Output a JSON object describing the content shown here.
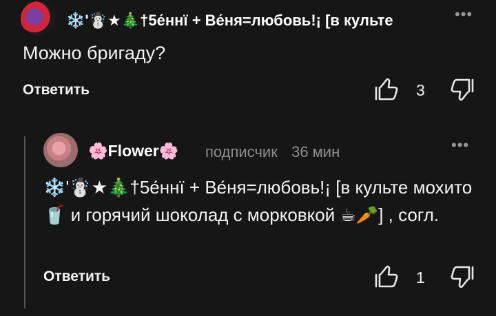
{
  "comment1": {
    "author": "❄️'☃️★🎄†5е́ннї + Ве́ня=любовь!¡ [в культе",
    "text": "Можно бригаду?",
    "reply_label": "Ответить",
    "like_count": "3",
    "menu_glyph": "•••"
  },
  "comment2": {
    "author": "🌸Flower🌸",
    "badge": "подписчик",
    "time": "36 мин",
    "text": "❄️'☃️★🎄†5е́ннї + Ве́ня=любовь!¡ [в культе мохито 🥤 и горячий шоколад с морковкой ☕🥕] , согл.",
    "reply_label": "Ответить",
    "like_count": "1",
    "menu_glyph": "•••"
  },
  "icons": [
    "avatar",
    "more-menu-icon",
    "thumb-up-icon",
    "thumb-down-icon"
  ]
}
